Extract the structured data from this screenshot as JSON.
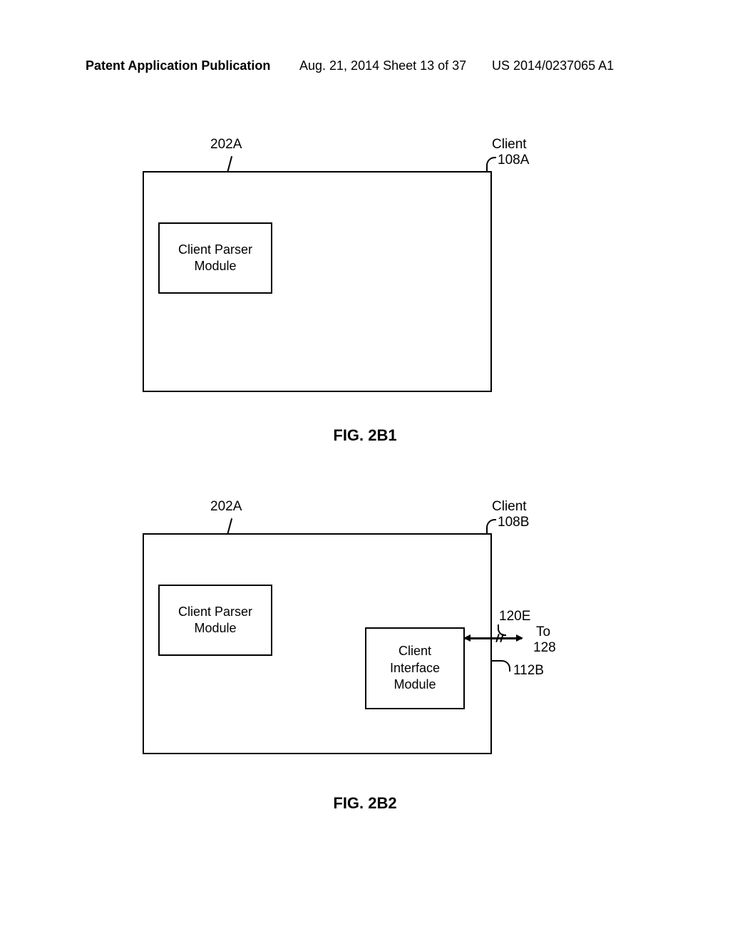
{
  "header": {
    "publication": "Patent Application Publication",
    "date_sheet": "Aug. 21, 2014  Sheet 13 of 37",
    "pub_number": "US 2014/0237065 A1"
  },
  "fig1": {
    "ref_parser": "202A",
    "parser_line1": "Client Parser",
    "parser_line2": "Module",
    "client_label_top": "Client",
    "client_ref": "108A",
    "caption": "FIG. 2B1"
  },
  "fig2": {
    "ref_parser": "202A",
    "parser_line1": "Client Parser",
    "parser_line2": "Module",
    "client_label_top": "Client",
    "client_ref": "108B",
    "iface_line1": "Client",
    "iface_line2": "Interface",
    "iface_line3": "Module",
    "ref_120e": "120E",
    "to_line1": "To",
    "to_line2": "128",
    "ref_112b": "112B",
    "caption": "FIG. 2B2"
  }
}
